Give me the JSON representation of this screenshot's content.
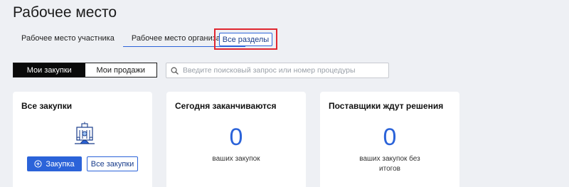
{
  "page": {
    "title": "Рабочее место"
  },
  "tabs": [
    {
      "label": "Рабочее место участника"
    },
    {
      "label": "Рабочее место организатора"
    }
  ],
  "all_sections": {
    "label": "Все разделы"
  },
  "toggle": {
    "my_purchases": "Мои закупки",
    "my_sales": "Мои продажи"
  },
  "search": {
    "placeholder": "Введите поисковый запрос или номер процедуры"
  },
  "cards": [
    {
      "title": "Все закупки",
      "primary_button": "Закупка",
      "secondary_button": "Все закупки"
    },
    {
      "title": "Сегодня заканчиваются",
      "count": "0",
      "subtitle": "ваших закупок"
    },
    {
      "title": "Поставщики ждут решения",
      "count": "0",
      "subtitle": "ваших закупок без итогов"
    }
  ],
  "colors": {
    "accent": "#2b63d9",
    "highlight": "#e0262f",
    "background": "#eef0f4"
  },
  "icons": {
    "search": "search-icon",
    "plus": "plus-circle-icon",
    "illustration": "building-people-icon"
  }
}
